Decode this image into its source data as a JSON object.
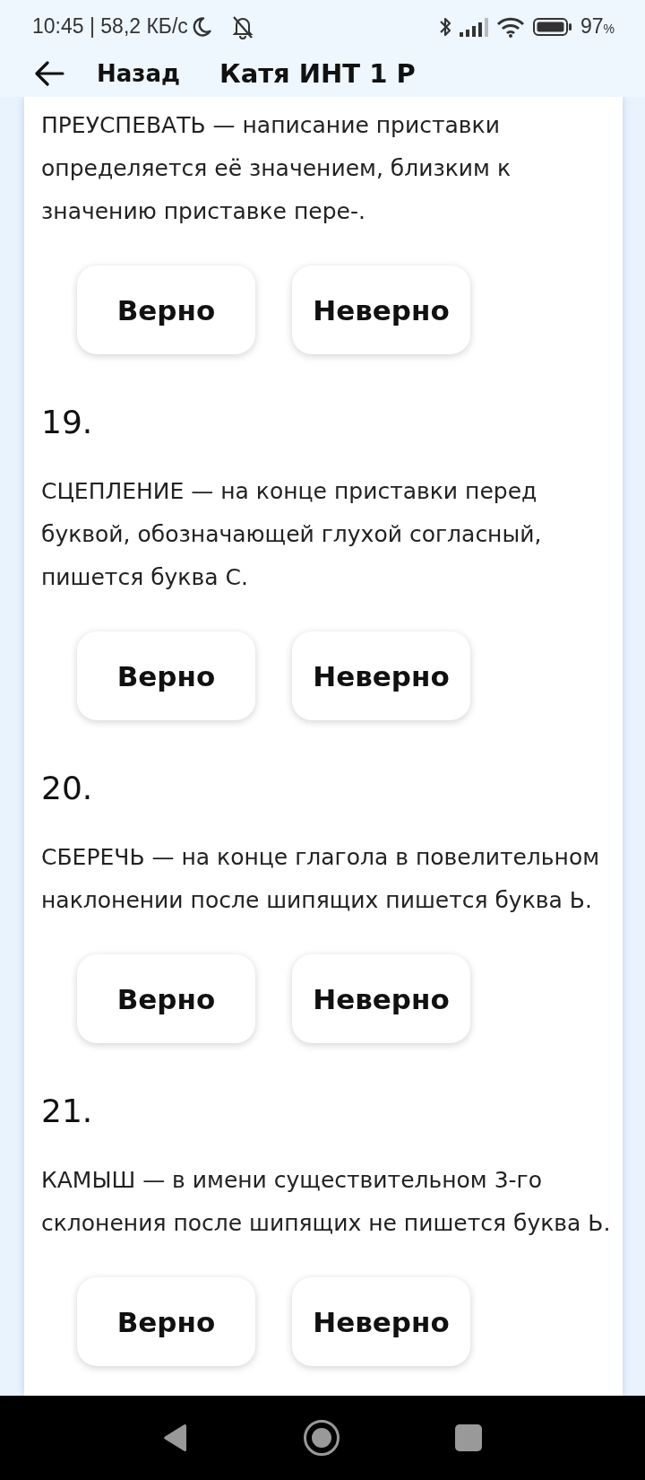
{
  "status_bar": {
    "status_text": "10:45 | 58,2 КБ/с",
    "battery": "97",
    "battery_unit": "%"
  },
  "header": {
    "back_label": "Назад",
    "title": "Катя ИНТ 1 Р"
  },
  "questions": [
    {
      "statement": "ПРЕУСПЕВАТЬ — написание приставки определяется её значением, близким к значению приставке пере-.",
      "answers": [
        "Верно",
        "Неверно"
      ]
    },
    {
      "number": "19.",
      "statement": "СЦЕПЛЕНИЕ — на конце приставки перед буквой, обозначающей глухой согласный, пишется буква С.",
      "answers": [
        "Верно",
        "Неверно"
      ]
    },
    {
      "number": "20.",
      "statement": "СБЕРЕЧЬ — на конце глагола в повелительном наклонении после шипящих пишется буква Ь.",
      "answers": [
        "Верно",
        "Неверно"
      ]
    },
    {
      "number": "21.",
      "statement": "КАМЫШ — в имени существительном 3-го склонения после шипящих не пишется буква Ь.",
      "answers": [
        "Верно",
        "Неверно"
      ]
    }
  ]
}
